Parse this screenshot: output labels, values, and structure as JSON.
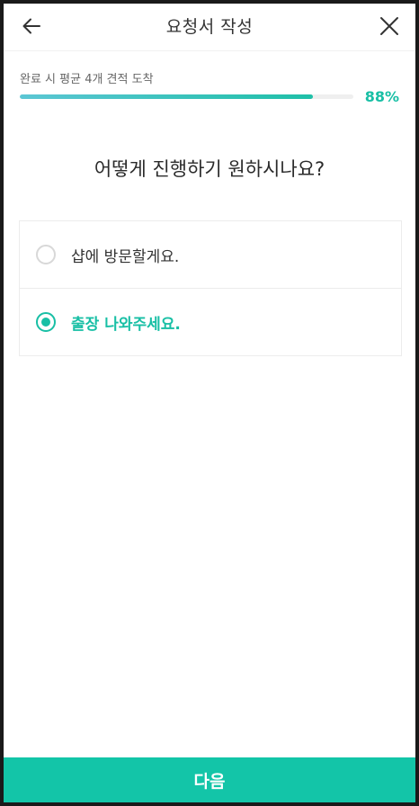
{
  "header": {
    "title": "요청서 작성",
    "back_icon": "arrow-left-icon",
    "close_icon": "close-icon"
  },
  "progress": {
    "label": "완료 시 평균 4개 견적 도착",
    "percent_text": "88%",
    "value": 0.88,
    "color": "#18bfa5"
  },
  "question": "어떻게 진행하기 원하시나요?",
  "options": [
    {
      "label": "샵에 방문할게요.",
      "selected": false
    },
    {
      "label": "출장 나와주세요.",
      "selected": true
    }
  ],
  "footer": {
    "next_label": "다음",
    "color": "#13c5a8"
  }
}
